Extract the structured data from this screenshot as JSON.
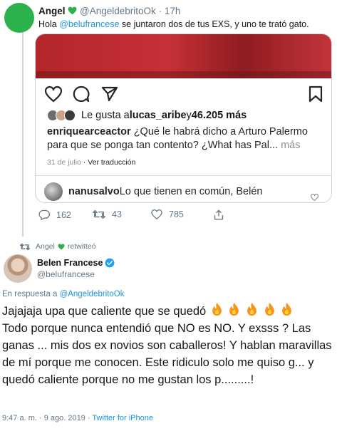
{
  "tweet": {
    "author_name": "Angel",
    "author_handle": "@AngeldebritoOk",
    "time": "· 17h",
    "text_prefix": "Hola ",
    "mention": "@belufrancese",
    "text_suffix": " se juntaron dos de tus EXS, y uno te trató gato.",
    "embed": {
      "likes_prefix": "Le gusta a ",
      "likes_user": "lucas_aribe",
      "likes_mid": " y ",
      "likes_count": "46.205 más",
      "caption_user": "enriquearceactor",
      "caption_text": " ¿Qué le habrá dicho a Arturo Palermo para que se ponga tan contento? ¿What has Pal...",
      "caption_more": " más",
      "date": "31 de julio",
      "translate": " · Ver traducción",
      "comment_user": "nanusalvo",
      "comment_text": " Lo que tienen en común, Belén"
    },
    "actions": {
      "replies": "162",
      "retweets": "43",
      "likes": "785"
    }
  },
  "retweet_line": {
    "user": "Angel",
    "label": "retwitteó"
  },
  "reply_tweet": {
    "author_name": "Belen Francese",
    "author_handle": "@belufrancese",
    "in_reply_prefix": "En respuesta a ",
    "in_reply_handle": "@AngeldebritoOk",
    "line1": "Jajajaja upa que caliente que se quedó",
    "body": "Todo porque nunca entendió que NO es NO. Y exsss ? Las ganas ... mis dos ex novios son caballeros!  Y hablan maravillas de mí porque me conocen. Este ridiculo solo me quiso g... y quedó caliente porque no me gustan los p.........!",
    "timestamp": "9:47 a. m. · 9 ago. 2019 · ",
    "source": "Twitter for iPhone"
  },
  "colors": {
    "link": "#1b95e0",
    "muted": "#657786",
    "heart_green": "#2bb24c",
    "verified": "#1da1f2"
  }
}
